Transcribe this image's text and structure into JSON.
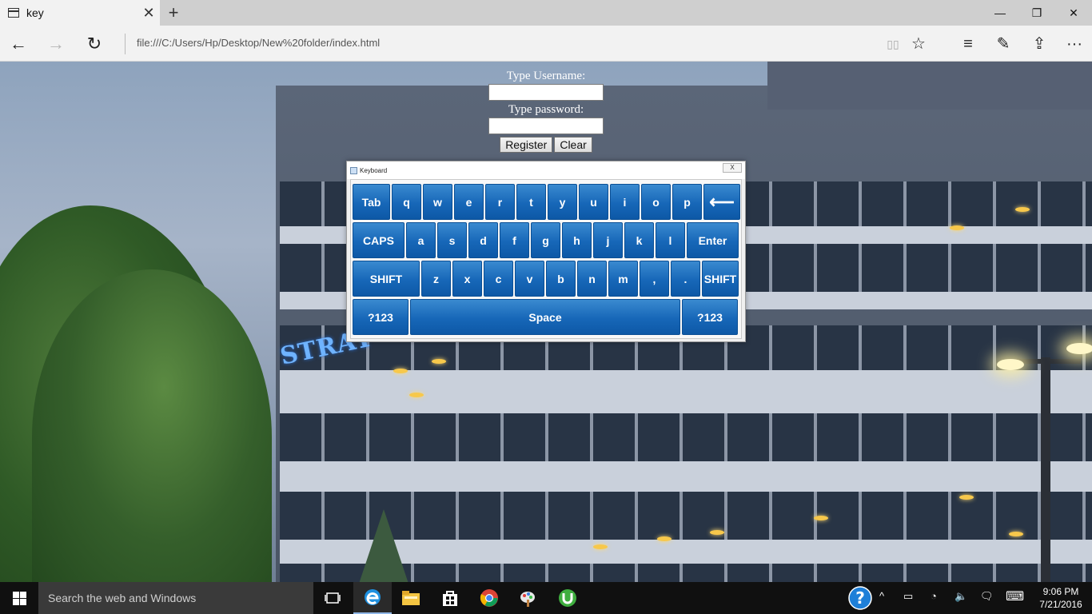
{
  "browser": {
    "tab_title": "key",
    "tab_close": "✕",
    "new_tab": "+",
    "window_controls": {
      "minimize": "—",
      "restore": "❐",
      "close": "✕"
    },
    "nav": {
      "back": "←",
      "forward": "→",
      "refresh": "↻"
    },
    "address": "file:///C:/Users/Hp/Desktop/New%20folder/index.html",
    "toolbar": {
      "reading": "▯▯",
      "favorite": "☆",
      "hub": "≡",
      "note": "✎",
      "share": "⇪",
      "more": "···"
    }
  },
  "form": {
    "username_label": "Type Username:",
    "password_label": "Type password:",
    "username_value": "",
    "password_value": "",
    "register_label": "Register",
    "clear_label": "Clear"
  },
  "background_sign": "STRAT",
  "keyboard": {
    "title": "Keyboard",
    "close": "X",
    "rows": [
      [
        "Tab",
        "q",
        "w",
        "e",
        "r",
        "t",
        "y",
        "u",
        "i",
        "o",
        "p",
        "⟵"
      ],
      [
        "CAPS",
        "a",
        "s",
        "d",
        "f",
        "g",
        "h",
        "j",
        "k",
        "l",
        "Enter"
      ],
      [
        "SHIFT",
        "z",
        "x",
        "c",
        "v",
        "b",
        "n",
        "m",
        ",",
        ".",
        "SHIFT"
      ],
      [
        "?123",
        "Space",
        "?123"
      ]
    ]
  },
  "taskbar": {
    "search_placeholder": "Search the web and Windows",
    "apps": [
      "task-view",
      "edge",
      "file-explorer",
      "store",
      "chrome",
      "paint",
      "utorrent"
    ],
    "tray": {
      "help": "?",
      "chevron": "^",
      "battery": "▭",
      "wifi": "◔",
      "volume": "🔈",
      "notifications": "🗨",
      "keyboard": "⌨"
    },
    "time": "9:06 PM",
    "date": "7/21/2016"
  },
  "colors": {
    "key_blue": "#1767b8",
    "taskbar": "#101010",
    "accent": "#1e90e0"
  }
}
